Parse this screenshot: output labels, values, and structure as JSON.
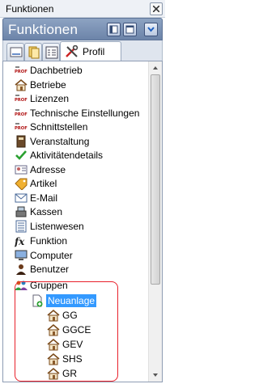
{
  "window": {
    "title": "Funktionen",
    "close_icon": "close-icon"
  },
  "header": {
    "title": "Funktionen",
    "buttons": [
      "dock-left-icon",
      "dock-window-icon",
      "pin-icon"
    ]
  },
  "tabs": [
    {
      "icon": "tab-list-icon",
      "label": ""
    },
    {
      "icon": "tab-documents-icon",
      "label": ""
    },
    {
      "icon": "tab-form-icon",
      "label": ""
    },
    {
      "icon": "tools-icon",
      "label": "Profil",
      "active": true
    }
  ],
  "tree": {
    "items": [
      {
        "label": "Dachbetrieb",
        "icon": "profil-icon"
      },
      {
        "label": "Betriebe",
        "icon": "house-icon"
      },
      {
        "label": "Lizenzen",
        "icon": "profil-icon"
      },
      {
        "label": "Technische Einstellungen",
        "icon": "profil-icon"
      },
      {
        "label": "Schnittstellen",
        "icon": "profil-icon"
      },
      {
        "label": "Veranstaltung",
        "icon": "book-icon"
      },
      {
        "label": "Aktivitätendetails",
        "icon": "checkmark-icon"
      },
      {
        "label": "Adresse",
        "icon": "address-card-icon"
      },
      {
        "label": "Artikel",
        "icon": "tag-icon"
      },
      {
        "label": "E-Mail",
        "icon": "email-icon"
      },
      {
        "label": "Kassen",
        "icon": "cash-register-icon"
      },
      {
        "label": "Listenwesen",
        "icon": "list-icon"
      },
      {
        "label": "Funktion",
        "icon": "fx-icon"
      },
      {
        "label": "Computer",
        "icon": "computer-icon"
      },
      {
        "label": "Benutzer",
        "icon": "user-icon"
      },
      {
        "label": "Gruppen",
        "icon": "group-icon"
      },
      {
        "label": "Neuanlage",
        "icon": "new-document-icon",
        "selected": true
      },
      {
        "label": "GG",
        "icon": "house-icon"
      },
      {
        "label": "GGCE",
        "icon": "house-icon"
      },
      {
        "label": "GEV",
        "icon": "house-icon"
      },
      {
        "label": "SHS",
        "icon": "house-icon"
      },
      {
        "label": "GR",
        "icon": "house-icon"
      }
    ]
  },
  "colors": {
    "header": "#7a90b6",
    "selection": "#3399ff",
    "highlight": "#e8202a"
  }
}
